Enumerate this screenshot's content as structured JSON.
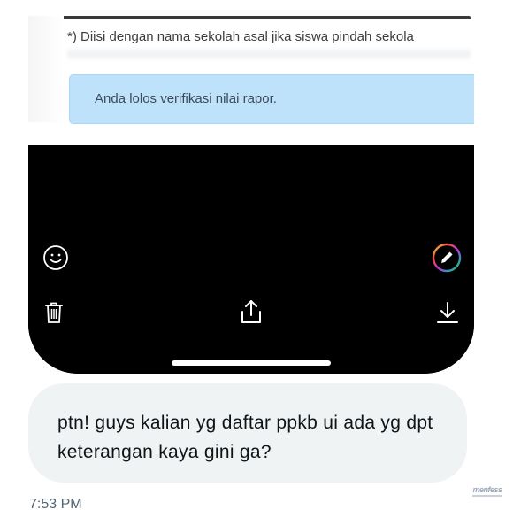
{
  "screenshot": {
    "note_text": "*) Diisi dengan nama sekolah asal jika siswa pindah sekola",
    "alert_text": "Anda lolos verifikasi nilai rapor."
  },
  "editor": {
    "icons": [
      "emoji-icon",
      "pen-icon",
      "trash-icon",
      "share-icon",
      "download-icon"
    ],
    "accent_ring": [
      "#f9ca24",
      "#f0932b",
      "#eb4d4b",
      "#be2edd",
      "#4834d4",
      "#22a6b3",
      "#6ab04c"
    ]
  },
  "message": {
    "text": "ptn! guys kalian yg daftar ppkb ui ada yg dpt keterangan kaya gini ga?",
    "timestamp": "7:53 PM"
  },
  "watermark": {
    "logo": "menfess"
  }
}
